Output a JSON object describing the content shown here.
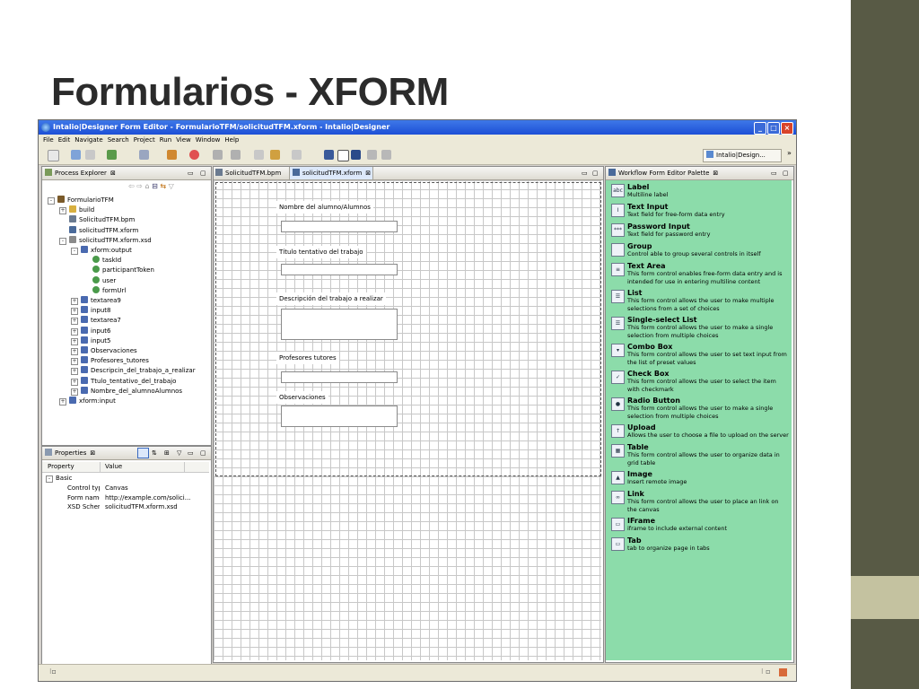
{
  "slide": {
    "title": "Formularios - XFORM"
  },
  "window": {
    "title": "Intalio|Designer Form Editor - FormularioTFM/solicitudTFM.xform - Intalio|Designer",
    "controls": {
      "minimize": "_",
      "maximize": "□",
      "close": "×"
    }
  },
  "menu": [
    "File",
    "Edit",
    "Navigate",
    "Search",
    "Project",
    "Run",
    "View",
    "Window",
    "Help"
  ],
  "perspective": {
    "label": "Intalio|Design..."
  },
  "process_explorer": {
    "title": "Process Explorer",
    "tree": [
      {
        "label": "FormularioTFM",
        "indent": 0,
        "icon": "project-icon",
        "exp": "-"
      },
      {
        "label": "build",
        "indent": 1,
        "icon": "folder-icon",
        "exp": "+"
      },
      {
        "label": "SolicitudTFM.bpm",
        "indent": 1,
        "icon": "bpm-file-icon",
        "exp": ""
      },
      {
        "label": "solicitudTFM.xform",
        "indent": 1,
        "icon": "xform-file-icon",
        "exp": ""
      },
      {
        "label": "solicitudTFM.xform.xsd",
        "indent": 1,
        "icon": "xsd-file-icon",
        "exp": "-"
      },
      {
        "label": "xform:output",
        "indent": 2,
        "icon": "element-icon",
        "exp": "-"
      },
      {
        "label": "taskId",
        "indent": 3,
        "icon": "attribute-icon",
        "exp": ""
      },
      {
        "label": "participantToken",
        "indent": 3,
        "icon": "attribute-icon",
        "exp": ""
      },
      {
        "label": "user",
        "indent": 3,
        "icon": "attribute-icon",
        "exp": ""
      },
      {
        "label": "formUrl",
        "indent": 3,
        "icon": "attribute-icon",
        "exp": ""
      },
      {
        "label": "textarea9",
        "indent": 2,
        "icon": "element-icon",
        "exp": "+"
      },
      {
        "label": "input8",
        "indent": 2,
        "icon": "element-icon",
        "exp": "+"
      },
      {
        "label": "textarea7",
        "indent": 2,
        "icon": "element-icon",
        "exp": "+"
      },
      {
        "label": "input6",
        "indent": 2,
        "icon": "element-icon",
        "exp": "+"
      },
      {
        "label": "input5",
        "indent": 2,
        "icon": "element-icon",
        "exp": "+"
      },
      {
        "label": "Observaciones",
        "indent": 2,
        "icon": "element-icon",
        "exp": "+"
      },
      {
        "label": "Profesores_tutores",
        "indent": 2,
        "icon": "element-icon",
        "exp": "+"
      },
      {
        "label": "Descripcin_del_trabajo_a_realizar",
        "indent": 2,
        "icon": "element-icon",
        "exp": "+"
      },
      {
        "label": "Ttulo_tentativo_del_trabajo",
        "indent": 2,
        "icon": "element-icon",
        "exp": "+"
      },
      {
        "label": "Nombre_del_alumnoAlumnos",
        "indent": 2,
        "icon": "element-icon",
        "exp": "+"
      },
      {
        "label": "xform:input",
        "indent": 1,
        "icon": "element-icon",
        "exp": "+"
      }
    ]
  },
  "properties": {
    "title": "Properties",
    "columns": [
      "Property",
      "Value"
    ],
    "group": "Basic",
    "rows": [
      {
        "property": "Control typ",
        "value": "Canvas"
      },
      {
        "property": "Form name",
        "value": "http://example.com/solici..."
      },
      {
        "property": "XSD Schem",
        "value": "solicitudTFM.xform.xsd"
      }
    ]
  },
  "editor": {
    "tabs": [
      {
        "label": "SolicitudTFM.bpm",
        "active": false
      },
      {
        "label": "solicitudTFM.xform",
        "active": true
      }
    ],
    "form_labels": [
      "Nombre del alumno/Alumnos",
      "Título tentativo del trabajo",
      "Descripción del trabajo a realizar",
      "Profesores tutores",
      "Observaciones"
    ]
  },
  "palette": {
    "title": "Workflow Form Editor Palette",
    "bg_color": "#8cdcaa",
    "items": [
      {
        "title": "Label",
        "desc": "Multiline label",
        "icon": "label-icon",
        "glyph": "abc"
      },
      {
        "title": "Text Input",
        "desc": "Text field for free-form data entry",
        "icon": "text-input-icon",
        "glyph": "I"
      },
      {
        "title": "Password Input",
        "desc": "Text field for password entry",
        "icon": "password-input-icon",
        "glyph": "***"
      },
      {
        "title": "Group",
        "desc": "Control able to group several controls in itself",
        "icon": "group-icon",
        "glyph": ""
      },
      {
        "title": "Text Area",
        "desc": "This form control enables free-form data entry and is intended for use in entering multiline content",
        "icon": "text-area-icon",
        "glyph": "≡"
      },
      {
        "title": "List",
        "desc": "This form control allows the user to make multiple selections from a set of choices",
        "icon": "list-icon",
        "glyph": "☰"
      },
      {
        "title": "Single-select List",
        "desc": "This form control allows the user to make a single selection from multiple choices",
        "icon": "single-select-list-icon",
        "glyph": "☰"
      },
      {
        "title": "Combo Box",
        "desc": "This form control allows the user to set text input from the list of preset values",
        "icon": "combo-box-icon",
        "glyph": "▾"
      },
      {
        "title": "Check Box",
        "desc": "This form control allows the user to select the item with checkmark",
        "icon": "check-box-icon",
        "glyph": "✓"
      },
      {
        "title": "Radio Button",
        "desc": "This form control allows the user to make a single selection from multiple choices",
        "icon": "radio-button-icon",
        "glyph": "●"
      },
      {
        "title": "Upload",
        "desc": "Allows the user to choose a file to upload on the server",
        "icon": "upload-icon",
        "glyph": "↑"
      },
      {
        "title": "Table",
        "desc": "This form control allows the user to organize data in grid table",
        "icon": "table-icon",
        "glyph": "▦"
      },
      {
        "title": "Image",
        "desc": "Insert remote image",
        "icon": "image-icon",
        "glyph": "▲"
      },
      {
        "title": "Link",
        "desc": "This form control allows the user to place an link on the canvas",
        "icon": "link-icon",
        "glyph": "∞"
      },
      {
        "title": "IFrame",
        "desc": "iframe to include external content",
        "icon": "iframe-icon",
        "glyph": "▭"
      },
      {
        "title": "Tab",
        "desc": "tab to organize page in tabs",
        "icon": "tab-icon",
        "glyph": "▭"
      }
    ]
  }
}
